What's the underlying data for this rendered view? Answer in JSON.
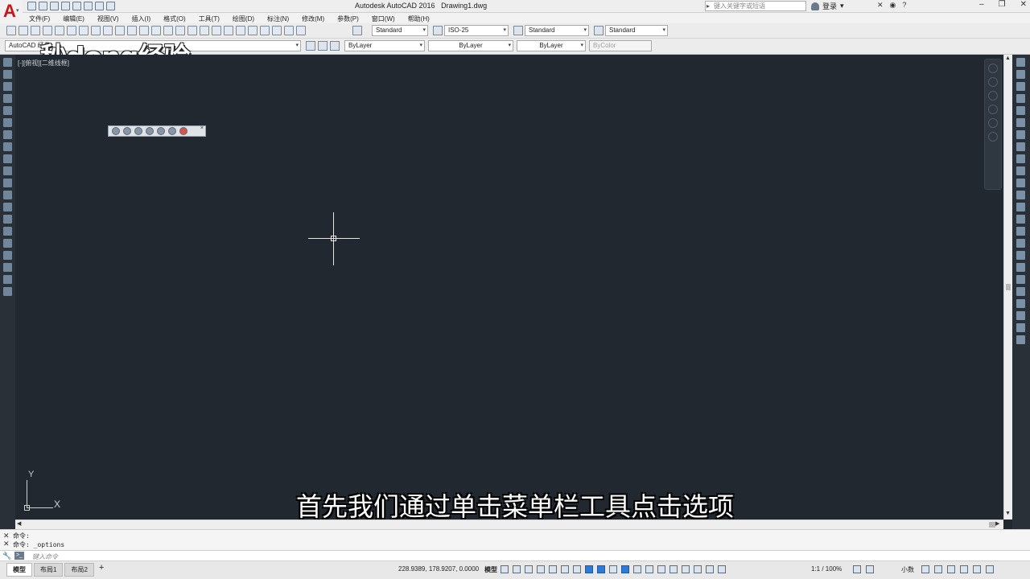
{
  "title": {
    "app": "Autodesk AutoCAD 2016",
    "file": "Drawing1.dwg",
    "search_placeholder": "键入关键字或短语",
    "login": "登录"
  },
  "menu": [
    "文件(F)",
    "编辑(E)",
    "视图(V)",
    "插入(I)",
    "格式(O)",
    "工具(T)",
    "绘图(D)",
    "标注(N)",
    "修改(M)",
    "参数(P)",
    "窗口(W)",
    "帮助(H)"
  ],
  "styles": {
    "text_style": "Standard",
    "dim_style": "ISO-25",
    "table_style": "Standard",
    "mleader_style": "Standard"
  },
  "layers": {
    "workspace": "AutoCAD 经典",
    "color": "ByLayer",
    "linetype": "ByLayer",
    "lineweight": "ByLayer",
    "plotstyle": "ByColor"
  },
  "watermark": "秒dong经验",
  "viewport_label": "[-][俯视][二维线框]",
  "ucs": {
    "x": "X",
    "y": "Y"
  },
  "subtitle": "首先我们通过单击菜单栏工具点击选项",
  "command": {
    "history": [
      "命令:",
      "命令: _options"
    ],
    "prompt_placeholder": "键入命令"
  },
  "status": {
    "tabs": [
      "模型",
      "布局1",
      "布局2"
    ],
    "coords": "228.9389, 178.9207, 0.0000",
    "model": "模型",
    "scale": "1:1 / 100%",
    "units": "小数"
  },
  "colors": {
    "canvas": "#212830",
    "accent": "#c8151b"
  }
}
